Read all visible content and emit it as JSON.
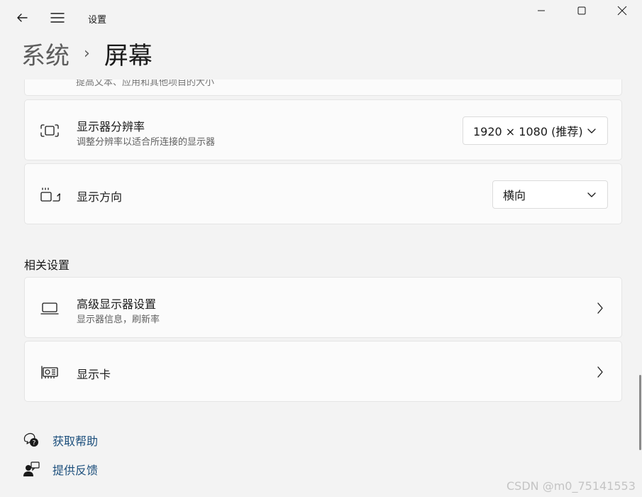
{
  "titlebar": {
    "app_title": "设置",
    "back_icon": "arrow-left-icon",
    "menu_icon": "hamburger-icon",
    "minimize_icon": "minimize-icon",
    "maximize_icon": "maximize-icon",
    "close_icon": "close-icon"
  },
  "breadcrumb": {
    "parent": "系统",
    "separator": "›",
    "current": "屏幕"
  },
  "partial_card": {
    "sub_partial": "提高文本、应用和其他项目的大小"
  },
  "resolution": {
    "icon": "resolution-icon",
    "title": "显示器分辨率",
    "subtitle": "调整分辨率以适合所连接的显示器",
    "value": "1920 × 1080 (推荐)"
  },
  "orientation": {
    "icon": "orientation-icon",
    "title": "显示方向",
    "value": "横向"
  },
  "related": {
    "heading": "相关设置",
    "advanced": {
      "icon": "laptop-icon",
      "title": "高级显示器设置",
      "subtitle": "显示器信息，刷新率"
    },
    "gpu": {
      "icon": "graphics-card-icon",
      "title": "显示卡"
    }
  },
  "footer_links": {
    "help": "获取帮助",
    "feedback": "提供反馈"
  },
  "watermark": "CSDN @m0_75141553",
  "colors": {
    "background": "#f3f3f3",
    "card": "#fbfbfb",
    "link": "#1c4f7c"
  }
}
